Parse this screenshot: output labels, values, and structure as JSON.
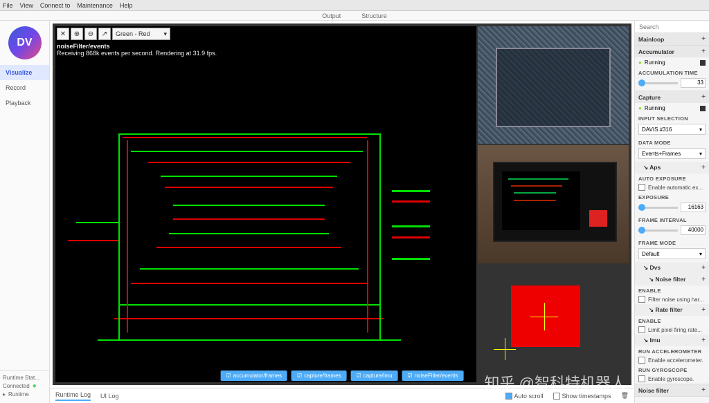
{
  "menubar": {
    "file": "File",
    "view": "View",
    "connect": "Connect to",
    "maintenance": "Maintenance",
    "help": "Help"
  },
  "toptabs": {
    "output": "Output",
    "structure": "Structure"
  },
  "logo_text": "DV",
  "sidebar": {
    "visualize": "Visualize",
    "record": "Record",
    "playback": "Playback"
  },
  "runtime_status": {
    "label": "Runtime Stat...",
    "value": "Connected",
    "runtime": "Runtime"
  },
  "toolbar": {
    "close": "✕",
    "zoom_in": "⊕",
    "zoom_out": "⊖",
    "move": "↗"
  },
  "color_select": {
    "label": "Green - Red",
    "caret": "▾"
  },
  "view_path": "noiseFilter/events",
  "view_status": "Receiving 868k events per second. Rendering at 31.9 fps.",
  "bottom_tabs": [
    "accumulator/frames",
    "capture/frames",
    "capture/imu",
    "noiseFilter/events"
  ],
  "logtabs": {
    "runtime": "Runtime Log",
    "ui": "UI Log",
    "autoscroll": "Auto scroll",
    "timestamps": "Show timestamps"
  },
  "search_placeholder": "Search",
  "right": {
    "mainloop": "Mainloop",
    "accumulator": "Accumulator",
    "running": "Running",
    "accum_time": "ACCUMULATION TIME",
    "accum_val": "33",
    "capture": "Capture",
    "input_sel": "INPUT SELECTION",
    "input_val": "DAVIS #316",
    "data_mode": "DATA MODE",
    "data_val": "Events+Frames",
    "aps": "Aps",
    "auto_exp": "AUTO EXPOSURE",
    "auto_exp_chk": "Enable automatic ex...",
    "exposure": "EXPOSURE",
    "exposure_val": "16163",
    "frame_int": "FRAME INTERVAL",
    "frame_val": "40000",
    "frame_mode": "FRAME MODE",
    "frame_mode_val": "Default",
    "dvs": "Dvs",
    "noise_filter": "Noise filter",
    "enable": "ENABLE",
    "filter_noise": "Filter noise using har...",
    "rate_filter": "Rate filter",
    "limit_pixel": "Limit pixel firing rate...",
    "imu": "Imu",
    "run_accel": "RUN ACCELEROMETER",
    "enable_accel": "Enable accelerometer.",
    "run_gyro": "RUN GYROSCOPE",
    "enable_gyro": "Enable gyroscope.",
    "noise_filter2": "Noise filter"
  }
}
